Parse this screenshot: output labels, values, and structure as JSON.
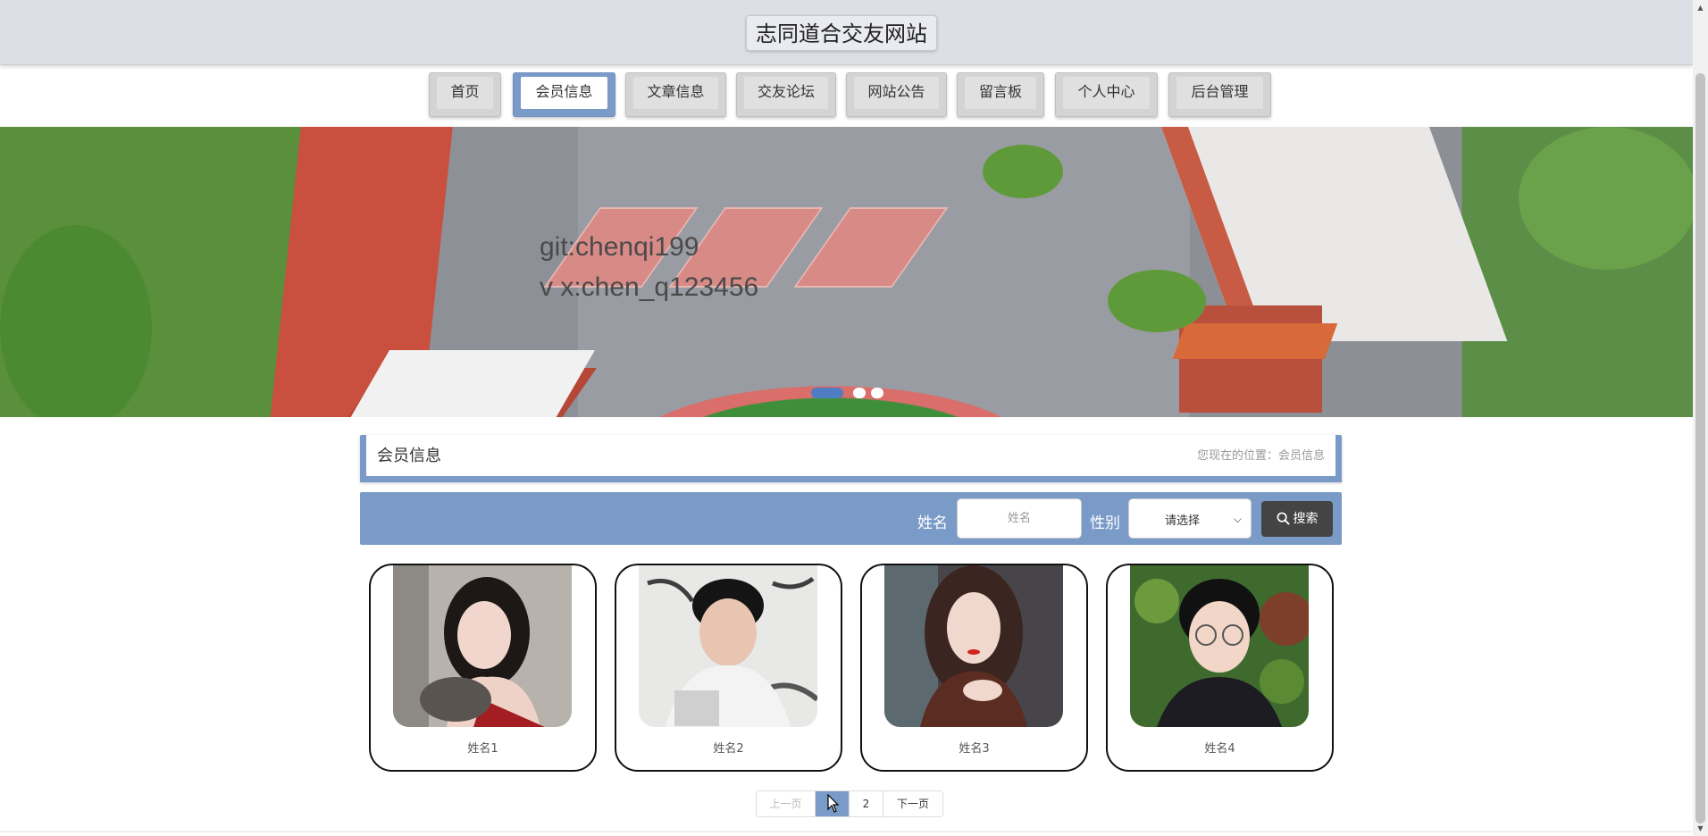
{
  "header": {
    "site_title": "志同道合交友网站"
  },
  "nav": {
    "items": [
      {
        "label": "首页"
      },
      {
        "label": "会员信息"
      },
      {
        "label": "文章信息"
      },
      {
        "label": "交友论坛"
      },
      {
        "label": "网站公告"
      },
      {
        "label": "留言板"
      },
      {
        "label": "个人中心"
      },
      {
        "label": "后台管理"
      }
    ],
    "active_index": 1
  },
  "banner": {
    "line1": "git:chenqi199",
    "line2": "v x:chen_q123456",
    "slide_count": 3,
    "active_slide": 0
  },
  "location": {
    "title": "会员信息",
    "breadcrumb": "您现在的位置：会员信息"
  },
  "search": {
    "name_label": "姓名",
    "name_placeholder": "姓名",
    "gender_label": "性别",
    "gender_selected": "请选择",
    "button_label": "搜索"
  },
  "members": [
    {
      "name": "姓名1"
    },
    {
      "name": "姓名2"
    },
    {
      "name": "姓名3"
    },
    {
      "name": "姓名4"
    }
  ],
  "pagination": {
    "prev": "上一页",
    "pages": [
      "1",
      "2"
    ],
    "current": "1",
    "next": "下一页"
  },
  "colors": {
    "accent": "#7a9bc8",
    "header_bg": "#dcdfe6",
    "search_button": "#444444",
    "active_dot": "#4e7dc3"
  }
}
